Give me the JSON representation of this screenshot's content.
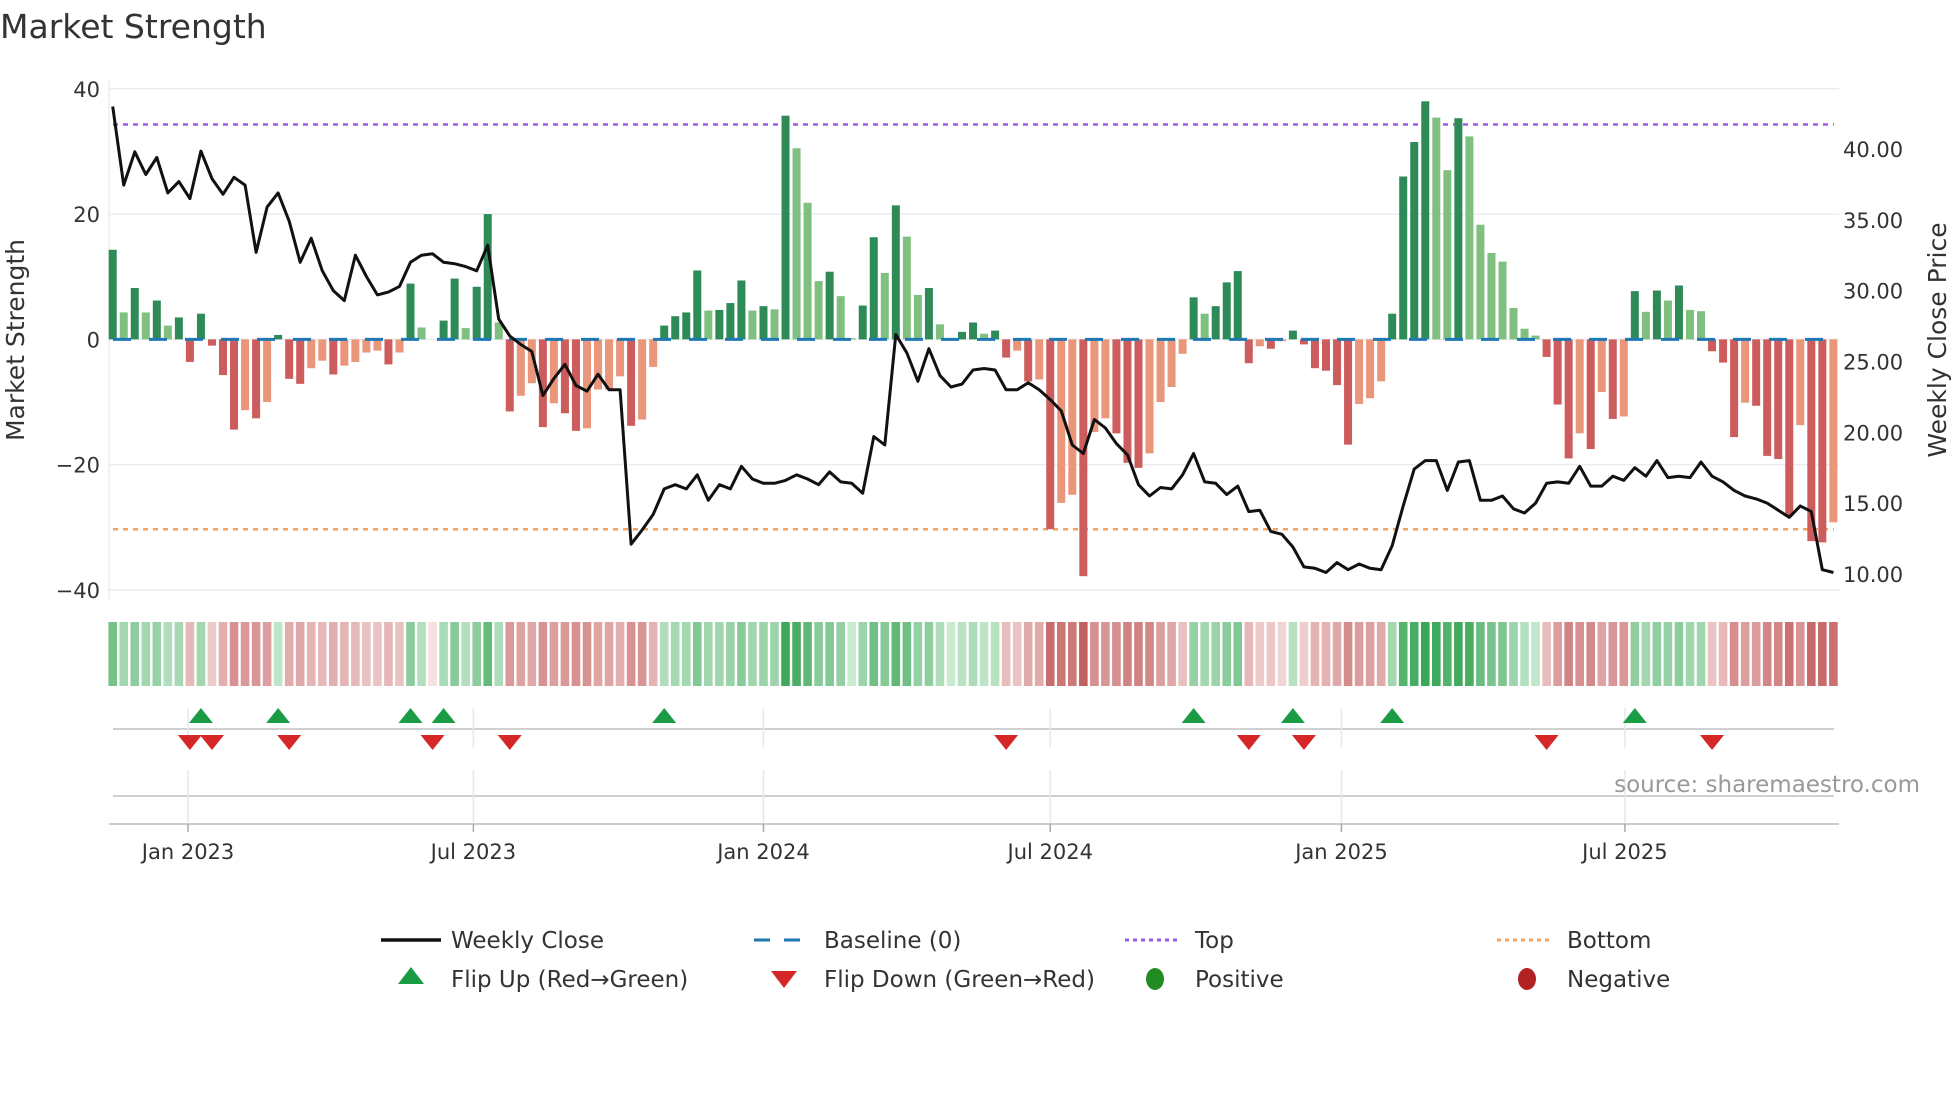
{
  "chart_data": {
    "type": "bar",
    "title": "Market Strength",
    "ylabel": "Market Strength",
    "y2label": "Weekly Close Price",
    "ylim": [
      -41.6,
      41.4
    ],
    "y2lim": [
      8.16,
      44.87
    ],
    "yticks": [
      40,
      20,
      0,
      -20,
      -40
    ],
    "ytick_labels": [
      "40",
      "20",
      "0",
      "−20",
      "−40"
    ],
    "y2ticks": [
      40,
      35,
      30,
      25,
      20,
      15,
      10
    ],
    "y2tick_labels": [
      "40.00",
      "35.00",
      "30.00",
      "25.00",
      "20.00",
      "15.00",
      "10.00"
    ],
    "xticks": [
      {
        "week": 6.83,
        "label": "Jan 2023"
      },
      {
        "week": 32.7,
        "label": "Jul 2023"
      },
      {
        "week": 59.0,
        "label": "Jan 2024"
      },
      {
        "week": 85.0,
        "label": "Jul 2024"
      },
      {
        "week": 111.4,
        "label": "Jan 2025"
      },
      {
        "week": 137.1,
        "label": "Jul 2025"
      }
    ],
    "top_level": 34.3,
    "bottom_level": -30.3,
    "baseline": 0,
    "grid": true,
    "strength": [
      14.3,
      4.3,
      8.2,
      4.3,
      6.2,
      2.2,
      3.5,
      -3.6,
      4.1,
      -1,
      -5.7,
      -14.4,
      -11.3,
      -12.6,
      -10,
      0.7,
      -6.3,
      -7.1,
      -4.6,
      -3.4,
      -5.6,
      -4.2,
      -3.6,
      -2.1,
      -1.8,
      -4,
      -2.1,
      8.9,
      1.9,
      0,
      3,
      9.7,
      1.8,
      8.4,
      20,
      2.7,
      -11.5,
      -9,
      -7,
      -14,
      -10.2,
      -11.8,
      -14.6,
      -14.2,
      -8,
      -8,
      -5.9,
      -13.8,
      -12.8,
      -4.4,
      2.2,
      3.7,
      4.3,
      11,
      4.6,
      4.7,
      5.8,
      9.4,
      4.6,
      5.3,
      4.8,
      35.7,
      30.5,
      21.8,
      9.3,
      10.8,
      6.9,
      0.2,
      5.4,
      16.3,
      10.6,
      21.4,
      16.4,
      7.1,
      8.2,
      2.4,
      0.2,
      1.2,
      2.7,
      0.9,
      1.4,
      -2.9,
      -1.8,
      -6.7,
      -6.4,
      -30.3,
      -26.1,
      -24.8,
      -37.8,
      -14.8,
      -12.6,
      -15,
      -19.7,
      -20.5,
      -18.2,
      -10,
      -7.6,
      -2.3,
      6.7,
      4.1,
      5.3,
      9.1,
      10.9,
      -3.8,
      -1.1,
      -1.5,
      -0.3,
      1.4,
      -0.8,
      -4.6,
      -5,
      -7.3,
      -16.8,
      -10.3,
      -9.4,
      -6.7,
      4.1,
      26,
      31.5,
      38,
      35.4,
      27,
      35.3,
      32.4,
      18.3,
      13.8,
      12.4,
      5,
      1.7,
      0.6,
      -2.8,
      -10.4,
      -19,
      -15,
      -17.5,
      -8.4,
      -12.7,
      -12.3,
      7.7,
      4.4,
      7.8,
      6.2,
      8.6,
      4.7,
      4.5,
      -1.9,
      -3.7,
      -15.6,
      -10.1,
      -10.6,
      -18.6,
      -19.1,
      -28.2,
      -13.7,
      -32.2,
      -32.4,
      -29.2
    ],
    "weekly_close": [
      43.0,
      37.45,
      39.8,
      38.2,
      39.4,
      36.9,
      37.7,
      36.5,
      39.85,
      37.9,
      36.8,
      38.0,
      37.45,
      32.7,
      35.9,
      36.9,
      34.9,
      32.0,
      33.7,
      31.4,
      30.0,
      29.3,
      32.5,
      31.0,
      29.7,
      29.9,
      30.3,
      32.0,
      32.5,
      32.6,
      32.0,
      31.9,
      31.7,
      31.4,
      33.2,
      28.0,
      26.8,
      26.2,
      25.7,
      22.6,
      23.8,
      24.8,
      23.3,
      22.9,
      24.1,
      23.0,
      23.0,
      12.1,
      13.1,
      14.2,
      16.0,
      16.3,
      16.0,
      17.0,
      15.2,
      16.3,
      16.0,
      17.6,
      16.7,
      16.4,
      16.4,
      16.6,
      17.0,
      16.7,
      16.3,
      17.2,
      16.5,
      16.4,
      15.7,
      19.7,
      19.1,
      26.9,
      25.6,
      23.6,
      25.9,
      24.0,
      23.2,
      23.4,
      24.4,
      24.5,
      24.4,
      23.0,
      23.0,
      23.5,
      23.0,
      22.3,
      21.5,
      19.1,
      18.5,
      20.9,
      20.3,
      19.2,
      18.4,
      16.3,
      15.5,
      16.1,
      16.0,
      17.0,
      18.5,
      16.5,
      16.4,
      15.6,
      16.2,
      14.4,
      14.5,
      13.0,
      12.8,
      11.9,
      10.5,
      10.4,
      10.1,
      10.8,
      10.3,
      10.7,
      10.4,
      10.3,
      12.0,
      14.8,
      17.4,
      18.0,
      18.0,
      15.9,
      17.9,
      18.0,
      15.2,
      15.2,
      15.5,
      14.6,
      14.3,
      15.0,
      16.4,
      16.5,
      16.4,
      17.6,
      16.2,
      16.2,
      16.9,
      16.6,
      17.5,
      16.9,
      18.0,
      16.8,
      16.9,
      16.8,
      17.9,
      16.9,
      16.5,
      15.9,
      15.5,
      15.3,
      15.0,
      14.5,
      14.0,
      14.8,
      14.4,
      10.3,
      10.1
    ],
    "flip_up_weeks": [
      8,
      15,
      27,
      30,
      50,
      98,
      107,
      116,
      138
    ],
    "flip_down_weeks": [
      7,
      9,
      16,
      29,
      36,
      81,
      103,
      108,
      130,
      145
    ],
    "legend": {
      "placement": "bottom",
      "items": [
        {
          "key": "close",
          "label": "Weekly Close"
        },
        {
          "key": "baseline",
          "label": "Baseline (0)"
        },
        {
          "key": "top",
          "label": "Top"
        },
        {
          "key": "bottom",
          "label": "Bottom"
        },
        {
          "key": "flip_up",
          "label": "Flip Up (Red→Green)"
        },
        {
          "key": "flip_down",
          "label": "Flip Down (Green→Red)"
        },
        {
          "key": "positive",
          "label": "Positive"
        },
        {
          "key": "negative",
          "label": "Negative"
        }
      ]
    },
    "source": "source: sharemaestro.com"
  },
  "colors": {
    "pos_rising": "#2e8b57",
    "pos_falling": "#7fbf7f",
    "neg_falling": "#cd5c5c",
    "neg_rising": "#e9967a",
    "close": "#111111",
    "baseline": "#1f77b4",
    "top": "#9b5de5",
    "bottom": "#f4a460",
    "flip_up": "#1a9c45",
    "flip_down": "#d62728",
    "positive": "#228b22",
    "negative": "#b22222"
  }
}
